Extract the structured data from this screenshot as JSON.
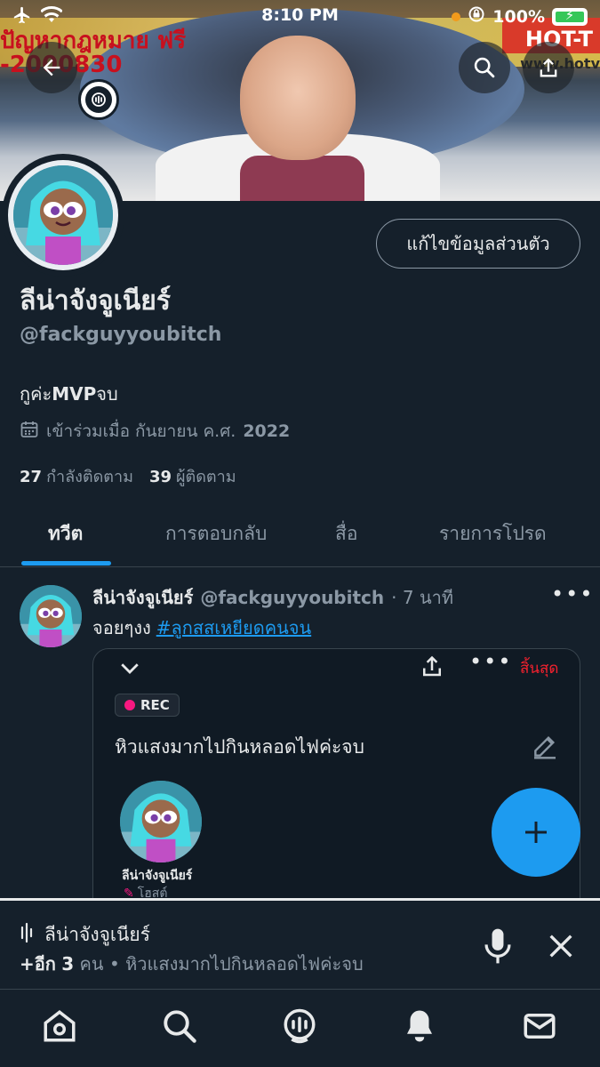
{
  "status_bar": {
    "time": "8:10 PM",
    "battery": "100%"
  },
  "banner": {
    "text_top_left": "ปัญหากฎหมาย ฟรี",
    "text_top_left_2": "-2000830",
    "text_top_right": "HOT-T",
    "text_top_right_2": "www.hotv"
  },
  "profile": {
    "edit_button": "แก้ไขข้อมูลส่วนตัว",
    "name": "ลีน่าจังจูเนียร์",
    "handle": "@fackguyyoubitch",
    "bio_prefix": "กูค่ะ",
    "bio_bold": "MVP",
    "bio_suffix": "จบ",
    "joined_text": "เข้าร่วมเมื่อ กันยายน ค.ศ.",
    "joined_year": "2022",
    "following_count": "27",
    "following_label": "กำลังติดตาม",
    "followers_count": "39",
    "followers_label": "ผู้ติดตาม"
  },
  "tabs": [
    {
      "label": "ทวีต"
    },
    {
      "label": "การตอบกลับ"
    },
    {
      "label": "สื่อ"
    },
    {
      "label": "รายการโปรด"
    }
  ],
  "tweet": {
    "author_name": "ลีน่าจังจูเนียร์",
    "author_handle": "@fackguyyoubitch",
    "time": "· 7 นาที",
    "text": "จอยๆงง",
    "hashtag": "#ลูกสสเหยียดคนจน",
    "more": "•••"
  },
  "space_card": {
    "end_label": "สิ้นสุด",
    "rec_label": "REC",
    "title": "หิวแสงมากไปกินหลอดไฟค่ะจบ",
    "host_name": "ลีน่าจังจูเนียร์",
    "host_role": "โฮสต์"
  },
  "space_dock": {
    "name": "ลีน่าจังจูเนียร์",
    "plus": "+อีก",
    "count": "3",
    "unit": "คน",
    "sep": "•",
    "title": "หิวแสงมากไปกินหลอดไฟค่ะจบ"
  },
  "colors": {
    "background": "#15202b",
    "accent": "#1d9bf0",
    "muted": "#8b98a5",
    "danger": "#f4212e"
  }
}
